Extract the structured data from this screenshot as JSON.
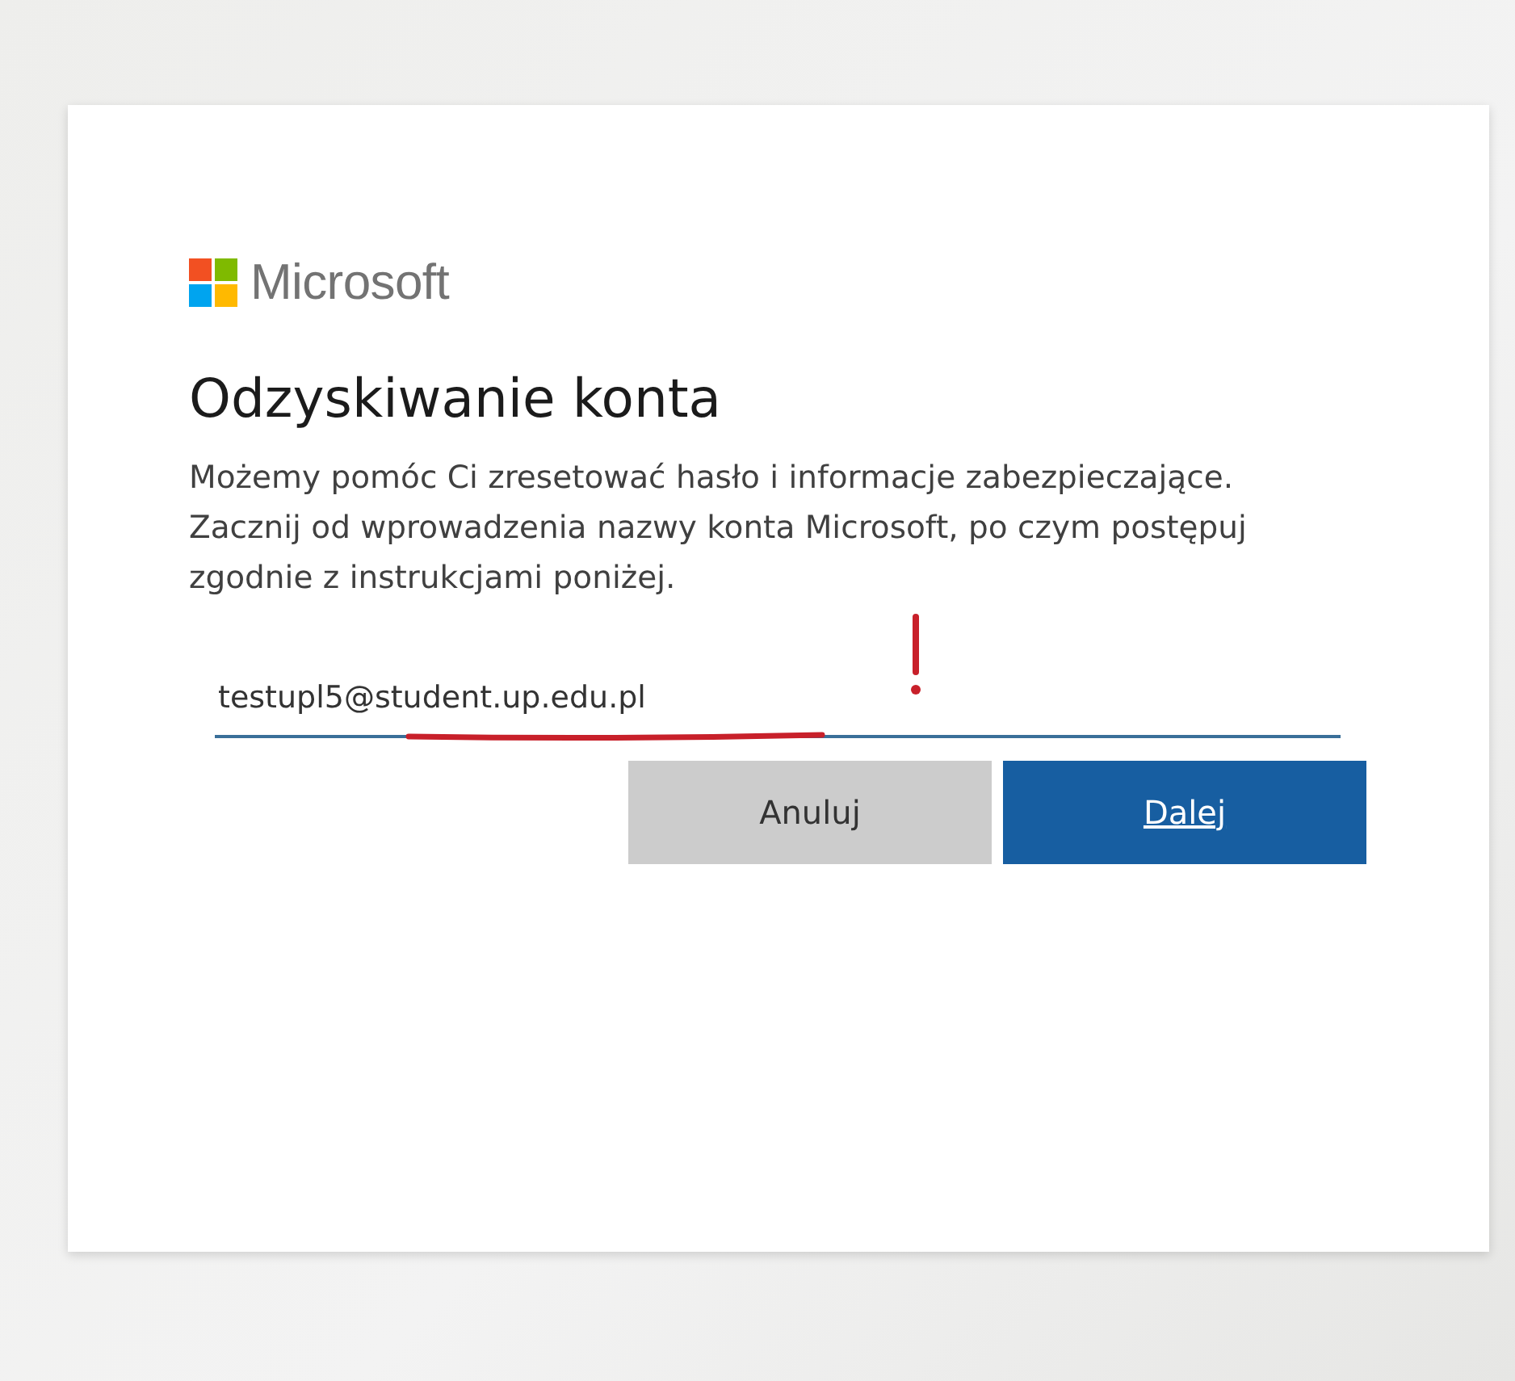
{
  "brand": {
    "name": "Microsoft"
  },
  "title": "Odzyskiwanie konta",
  "description": "Możemy pomóc Ci zresetować hasło i informacje zabezpieczające. Zacznij od wprowadzenia nazwy konta Microsoft, po czym postępuj zgodnie z instrukcjami poniżej.",
  "account_field": {
    "value": "testupl5@student.up.edu.pl"
  },
  "buttons": [
    {
      "label": "Anuluj",
      "kind": "secondary"
    },
    {
      "label": "Dalej",
      "kind": "primary"
    }
  ]
}
